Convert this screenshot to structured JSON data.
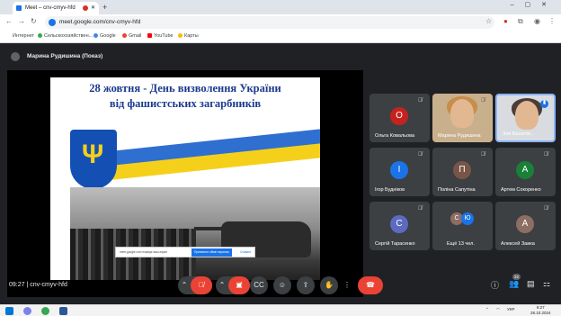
{
  "browser": {
    "tab_title": "Meet – cnv-cmyv-hfd",
    "url": "meet.google.com/cnv-cmyv-hfd",
    "bookmarks": [
      "Интернет",
      "Сельскохозяйствен...",
      "Google",
      "Gmail",
      "YouTube",
      "Карты"
    ]
  },
  "meet": {
    "presenter_label": "Марина Рудишина (Показ)",
    "slide": {
      "title_line1": "28 жовтня - День визволення України",
      "title_line2": "від фашистських загарбників"
    },
    "share_notice": {
      "text": "meet.google.com показує ваш екран",
      "stop_label": "Припинити обмін екраном",
      "hide_label": "Сховати"
    },
    "participants": [
      {
        "name": "Ольга Ковальова",
        "initial": "О",
        "color": "#c5221f"
      },
      {
        "name": "Марина Рудишина",
        "initial": "",
        "color": ""
      },
      {
        "name": "Зоя Василів...",
        "initial": "",
        "color": ""
      },
      {
        "name": "Ігор Будніков",
        "initial": "І",
        "color": "#1a73e8"
      },
      {
        "name": "Поліна Сапутіна",
        "initial": "П",
        "color": "#795548"
      },
      {
        "name": "Артем Сокоренко",
        "initial": "А",
        "color": "#188038"
      },
      {
        "name": "Сергій Тарасенко",
        "initial": "С",
        "color": "#5c6bc0"
      },
      {
        "name": "Ещё 13 чел.",
        "initial": "",
        "color": ""
      },
      {
        "name": "Алексей Заика",
        "initial": "А",
        "color": "#8d6e63"
      }
    ],
    "more_avatars": [
      "С",
      "Ю"
    ],
    "meeting_time": "09:27",
    "meeting_code": "cnv-cmyv-hfd",
    "people_count": "22"
  },
  "taskbar": {
    "language": "УКР",
    "time": "9:27",
    "date": "28.10.2024"
  }
}
